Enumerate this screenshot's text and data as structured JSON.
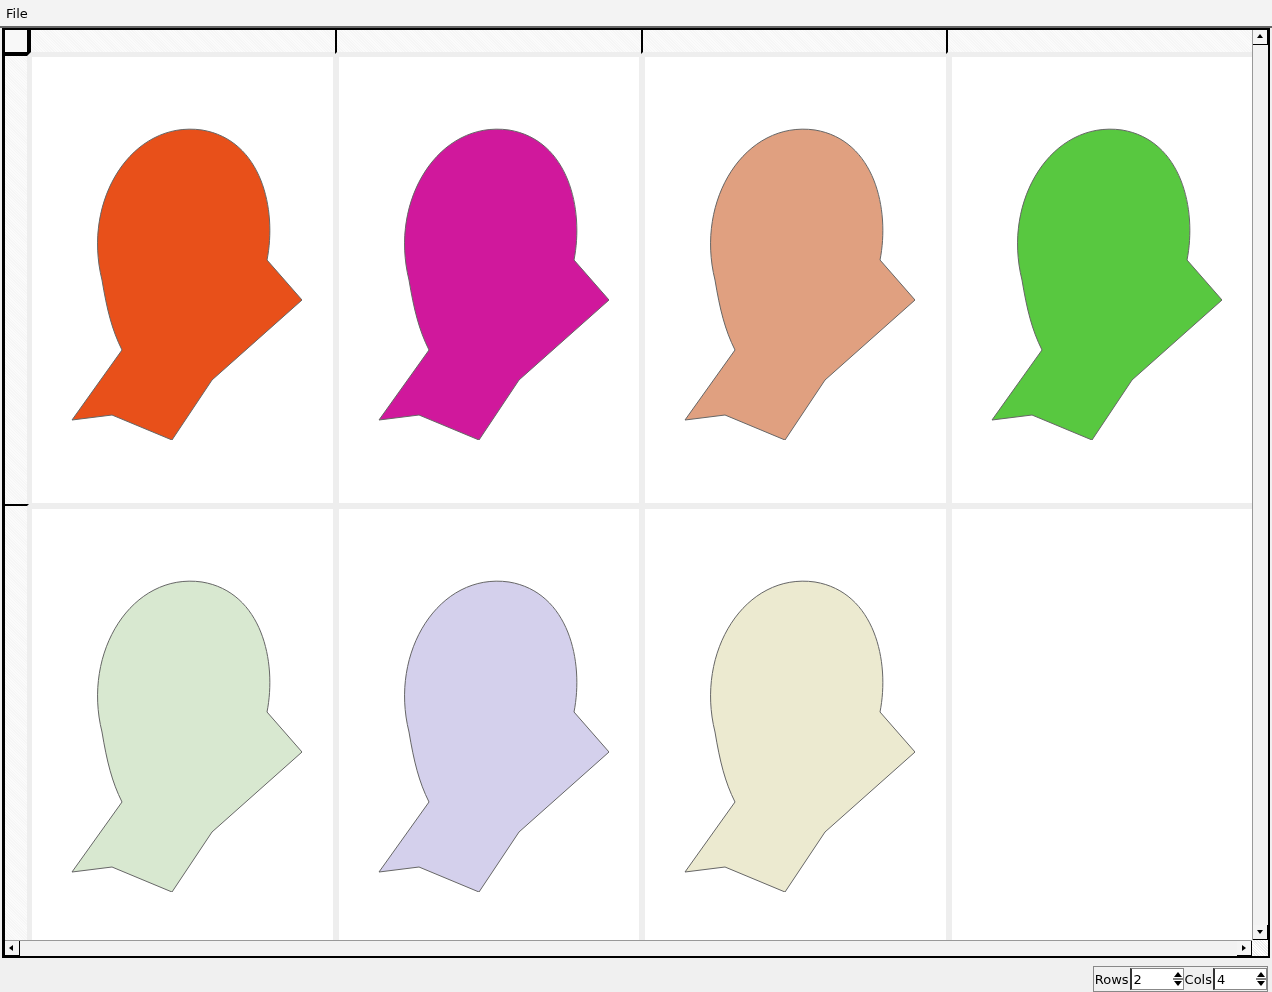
{
  "menu": [
    {
      "label": "File"
    }
  ],
  "grid": {
    "cells": [
      {
        "kind": "render",
        "color": "#e8501a"
      },
      {
        "kind": "render",
        "color": "#d0189c"
      },
      {
        "kind": "render",
        "color": "#e0a080"
      },
      {
        "kind": "render",
        "color": "#58c840"
      },
      {
        "kind": "render",
        "color": "#d8e8d0"
      },
      {
        "kind": "render",
        "color": "#d4d0ec"
      },
      {
        "kind": "render",
        "color": "#ecead0"
      },
      {
        "kind": "empty"
      }
    ]
  },
  "status_bar": {
    "rows_label": "Rows",
    "rows_value": "2",
    "cols_label": "Cols",
    "cols_value": "4"
  }
}
